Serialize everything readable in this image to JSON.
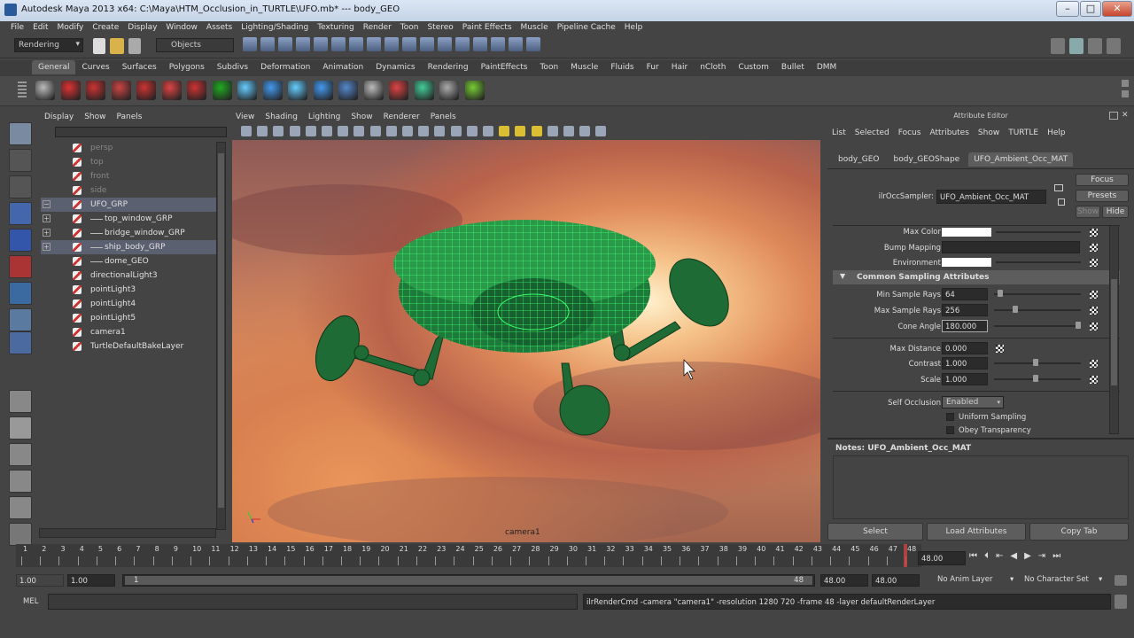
{
  "window": {
    "title": "Autodesk Maya 2013 x64: C:\\Maya\\HTM_Occlusion_in_TURTLE\\UFO.mb*   ---   body_GEO"
  },
  "menubar": [
    "File",
    "Edit",
    "Modify",
    "Create",
    "Display",
    "Window",
    "Assets",
    "Lighting/Shading",
    "Texturing",
    "Render",
    "Toon",
    "Stereo",
    "Paint Effects",
    "Muscle",
    "Pipeline Cache",
    "Help"
  ],
  "statusline": {
    "menu_set": "Rendering",
    "selection_mode": "Objects"
  },
  "shelf_tabs": [
    "General",
    "Curves",
    "Surfaces",
    "Polygons",
    "Subdivs",
    "Deformation",
    "Animation",
    "Dynamics",
    "Rendering",
    "PaintEffects",
    "Toon",
    "Muscle",
    "Fluids",
    "Fur",
    "Hair",
    "nCloth",
    "Custom",
    "Bullet",
    "DMM"
  ],
  "outliner": {
    "menu": [
      "Display",
      "Show",
      "Panels"
    ],
    "items": [
      {
        "label": "persp",
        "indent": 0,
        "dim": true,
        "expander": ""
      },
      {
        "label": "top",
        "indent": 0,
        "dim": true,
        "expander": ""
      },
      {
        "label": "front",
        "indent": 0,
        "dim": true,
        "expander": ""
      },
      {
        "label": "side",
        "indent": 0,
        "dim": true,
        "expander": ""
      },
      {
        "label": "UFO_GRP",
        "indent": 0,
        "selected": true,
        "expander": "−"
      },
      {
        "label": "top_window_GRP",
        "indent": 1,
        "expander": "+"
      },
      {
        "label": "bridge_window_GRP",
        "indent": 1,
        "expander": "+"
      },
      {
        "label": "ship_body_GRP",
        "indent": 1,
        "selected": true,
        "expander": "+"
      },
      {
        "label": "dome_GEO",
        "indent": 1,
        "expander": ""
      },
      {
        "label": "directionalLight3",
        "indent": 0,
        "expander": ""
      },
      {
        "label": "pointLight3",
        "indent": 0,
        "expander": ""
      },
      {
        "label": "pointLight4",
        "indent": 0,
        "expander": ""
      },
      {
        "label": "pointLight5",
        "indent": 0,
        "expander": ""
      },
      {
        "label": "camera1",
        "indent": 0,
        "expander": ""
      },
      {
        "label": "TurtleDefaultBakeLayer",
        "indent": 0,
        "expander": ""
      }
    ]
  },
  "viewport": {
    "menu": [
      "View",
      "Shading",
      "Lighting",
      "Show",
      "Renderer",
      "Panels"
    ],
    "camera_label": "camera1"
  },
  "attribute_editor": {
    "title": "Attribute Editor",
    "menu": [
      "List",
      "Selected",
      "Focus",
      "Attributes",
      "Show",
      "TURTLE",
      "Help"
    ],
    "tabs": [
      "body_GEO",
      "body_GEOShape",
      "UFO_Ambient_Occ_MAT"
    ],
    "sampler_label": "ilrOccSampler:",
    "sampler_value": "UFO_Ambient_Occ_MAT",
    "buttons": {
      "focus": "Focus",
      "presets": "Presets",
      "show": "Show",
      "hide": "Hide"
    },
    "rows_top": [
      {
        "label": "Max Color"
      },
      {
        "label": "Bump Mapping"
      },
      {
        "label": "Environment"
      }
    ],
    "section": "Common Sampling Attributes",
    "min_sample_rays": {
      "label": "Min Sample Rays",
      "value": "64"
    },
    "max_sample_rays": {
      "label": "Max Sample Rays",
      "value": "256"
    },
    "cone_angle": {
      "label": "Cone Angle",
      "value": "180.000"
    },
    "max_distance": {
      "label": "Max Distance",
      "value": "0.000"
    },
    "contrast": {
      "label": "Contrast",
      "value": "1.000"
    },
    "scale": {
      "label": "Scale",
      "value": "1.000"
    },
    "self_occlusion": {
      "label": "Self Occlusion",
      "value": "Enabled"
    },
    "uniform_sampling": "Uniform Sampling",
    "obey_transparency": "Obey Transparency",
    "notes": "Notes:  UFO_Ambient_Occ_MAT",
    "bottom_buttons": [
      "Select",
      "Load Attributes",
      "Copy Tab"
    ]
  },
  "timeline": {
    "ticks": [
      "1",
      "2",
      "3",
      "4",
      "5",
      "6",
      "7",
      "8",
      "9",
      "10",
      "11",
      "12",
      "13",
      "14",
      "15",
      "16",
      "17",
      "18",
      "19",
      "20",
      "21",
      "22",
      "23",
      "24",
      "25",
      "26",
      "27",
      "28",
      "29",
      "30",
      "31",
      "32",
      "33",
      "34",
      "35",
      "36",
      "37",
      "38",
      "39",
      "40",
      "41",
      "42",
      "43",
      "44",
      "45",
      "46",
      "47",
      "48"
    ],
    "current_frame": "48.00"
  },
  "range": {
    "start": "1.00",
    "start2": "1.00",
    "slider_start": "1",
    "slider_end": "48",
    "end": "48.00",
    "end2": "48.00",
    "anim_layer": "No Anim Layer",
    "char_set": "No Character Set"
  },
  "cmdline": {
    "label": "MEL",
    "result": "ilrRenderCmd -camera \"camera1\" -resolution 1280 720 -frame 48 -layer defaultRenderLayer"
  },
  "colors": {
    "accent": "#5a6070",
    "wireframe": "#3cff6a",
    "ufo_fill": "#1e6b35"
  }
}
